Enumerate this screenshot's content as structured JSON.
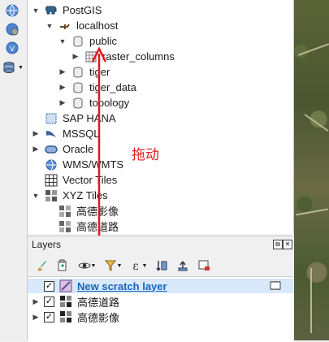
{
  "browser": {
    "items": [
      {
        "label": "PostGIS",
        "arrow": "▼",
        "icon": "elephant-icon"
      },
      {
        "label": "localhost",
        "arrow": "▼",
        "icon": "connection-icon"
      },
      {
        "label": "public",
        "arrow": "▼",
        "icon": "database-schema-icon"
      },
      {
        "label": "raster_columns",
        "arrow": "▶",
        "icon": "table-icon"
      },
      {
        "label": "tiger",
        "arrow": "▶",
        "icon": "database-schema-icon"
      },
      {
        "label": "tiger_data",
        "arrow": "▶",
        "icon": "database-schema-icon"
      },
      {
        "label": "topology",
        "arrow": "▶",
        "icon": "database-schema-icon"
      },
      {
        "label": "SAP HANA",
        "arrow": "",
        "icon": "sap-hana-icon"
      },
      {
        "label": "MSSQL",
        "arrow": "▶",
        "icon": "mssql-icon"
      },
      {
        "label": "Oracle",
        "arrow": "▶",
        "icon": "oracle-icon"
      },
      {
        "label": "WMS/WMTS",
        "arrow": "",
        "icon": "wms-globe-icon"
      },
      {
        "label": "Vector Tiles",
        "arrow": "",
        "icon": "vector-tiles-icon"
      },
      {
        "label": "XYZ Tiles",
        "arrow": "▼",
        "icon": "xyz-tiles-icon"
      },
      {
        "label": "高德影像",
        "arrow": "",
        "icon": "tile-layer-icon"
      },
      {
        "label": "高德道路",
        "arrow": "",
        "icon": "tile-layer-icon"
      }
    ]
  },
  "annotation": {
    "text": "拖动",
    "color": "#e0191b"
  },
  "layers": {
    "title": "Layers",
    "items": [
      {
        "label": "New scratch layer",
        "checked": "✓",
        "selected": true
      },
      {
        "label": "高德道路",
        "checked": "✓",
        "selected": false
      },
      {
        "label": "高德影像",
        "checked": "✓",
        "selected": false
      }
    ]
  },
  "colors": {
    "accent": "#1565c0",
    "annotation": "#e0191b",
    "selection": "#d9e8fb"
  }
}
